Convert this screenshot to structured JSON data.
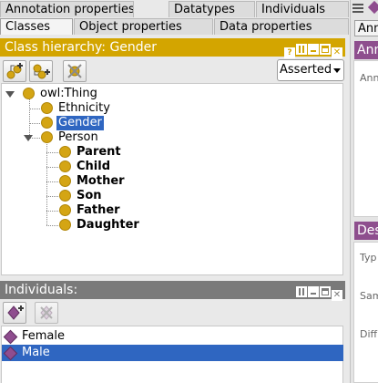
{
  "tabs_row1": [
    {
      "label": "Annotation properties"
    },
    {
      "label": "Datatypes"
    },
    {
      "label": "Individuals"
    }
  ],
  "tabs_row2": [
    {
      "label": "Classes",
      "selected": true
    },
    {
      "label": "Object properties"
    },
    {
      "label": "Data properties"
    }
  ],
  "class_hierarchy": {
    "title": "Class hierarchy: Gender",
    "title_color": "#d3a500",
    "view_select": "Asserted",
    "toolbar_icons": [
      "add-subclass-icon",
      "add-sibling-class-icon",
      "delete-class-icon"
    ],
    "tree": [
      {
        "label": "owl:Thing",
        "depth": 0,
        "expanded": true
      },
      {
        "label": "Ethnicity",
        "depth": 1
      },
      {
        "label": "Gender",
        "depth": 1,
        "selected": true
      },
      {
        "label": "Person",
        "depth": 1,
        "expanded": true
      },
      {
        "label": "Parent",
        "depth": 2,
        "bold": true
      },
      {
        "label": "Child",
        "depth": 2,
        "bold": true
      },
      {
        "label": "Mother",
        "depth": 2,
        "bold": true
      },
      {
        "label": "Son",
        "depth": 2,
        "bold": true
      },
      {
        "label": "Father",
        "depth": 2,
        "bold": true
      },
      {
        "label": "Daughter",
        "depth": 2,
        "bold": true
      }
    ]
  },
  "individuals": {
    "title": "Individuals:",
    "title_color": "#7a7a7a",
    "toolbar_icons": [
      "add-individual-icon",
      "delete-individual-icon"
    ],
    "items": [
      {
        "label": "Female"
      },
      {
        "label": "Male",
        "selected": true
      }
    ]
  },
  "right_panel": {
    "tab_label": "Ann",
    "annotations_title": "Ann",
    "annotations_color": "#8e4f8e",
    "annotations_field_label": "Anno",
    "description_title": "Des",
    "description_color": "#8e4f8e",
    "desc_labels": [
      "Typ",
      "Sam",
      "Diff"
    ]
  },
  "colors": {
    "selection": "#2f66c1",
    "class_icon": "#d4a514",
    "individual_icon": "#8f4d8f"
  }
}
